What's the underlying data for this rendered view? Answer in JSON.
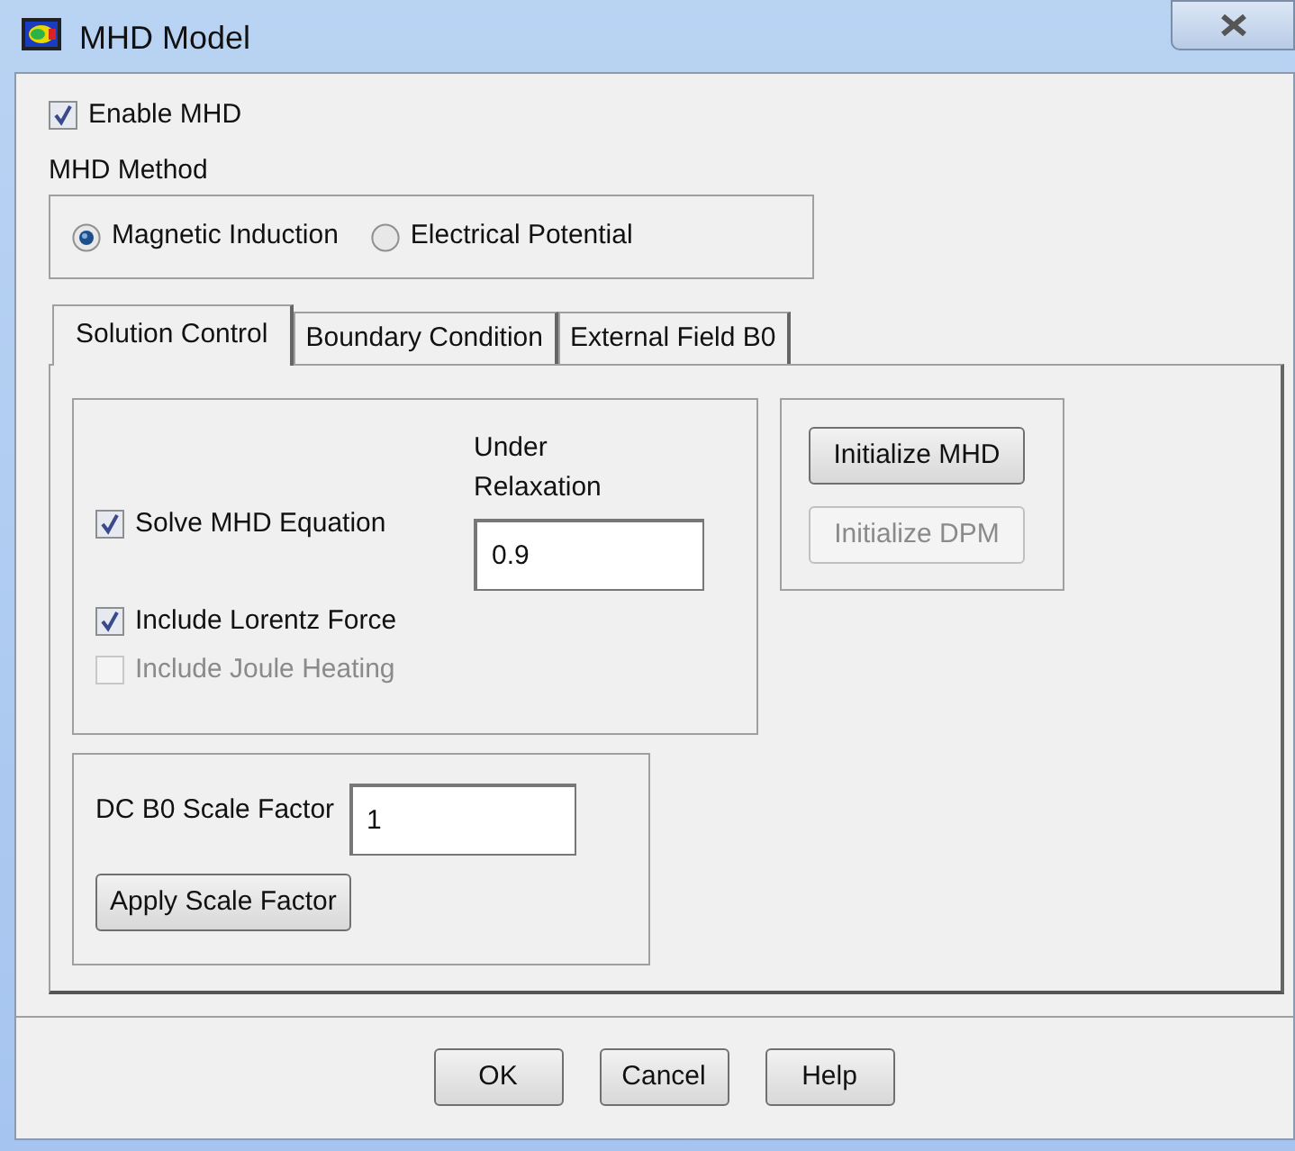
{
  "window": {
    "title": "MHD Model"
  },
  "enable_mhd": {
    "label": "Enable MHD",
    "checked": true
  },
  "mhd_method": {
    "label": "MHD Method",
    "options": [
      {
        "label": "Magnetic Induction",
        "selected": true
      },
      {
        "label": "Electrical Potential",
        "selected": false
      }
    ]
  },
  "tabs": [
    {
      "label": "Solution Control",
      "selected": true
    },
    {
      "label": "Boundary Condition",
      "selected": false
    },
    {
      "label": "External Field B0",
      "selected": false
    }
  ],
  "solution_control": {
    "under_relaxation": {
      "label": "Under Relaxation",
      "value": "0.9"
    },
    "checkboxes": [
      {
        "label": "Solve MHD Equation",
        "checked": true,
        "disabled": false
      },
      {
        "label": "Include Lorentz Force",
        "checked": true,
        "disabled": false
      },
      {
        "label": "Include Joule Heating",
        "checked": false,
        "disabled": true
      }
    ],
    "init_buttons": [
      {
        "label": "Initialize MHD",
        "disabled": false
      },
      {
        "label": "Initialize DPM",
        "disabled": true
      }
    ],
    "scale": {
      "label": "DC B0 Scale Factor",
      "value": "1",
      "button": "Apply Scale Factor"
    }
  },
  "buttons": [
    "OK",
    "Cancel",
    "Help"
  ]
}
